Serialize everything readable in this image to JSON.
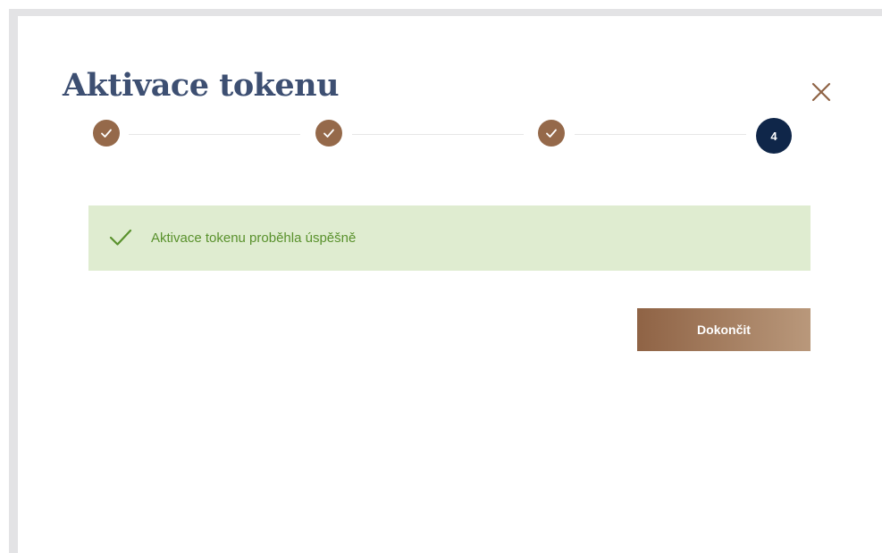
{
  "dialog": {
    "title": "Aktivace tokenu",
    "close_icon": "close-icon"
  },
  "stepper": {
    "steps": [
      {
        "state": "completed",
        "icon": "checkmark-icon"
      },
      {
        "state": "completed",
        "icon": "checkmark-icon"
      },
      {
        "state": "completed",
        "icon": "checkmark-icon"
      },
      {
        "state": "active",
        "label": "4"
      }
    ],
    "active_step": 4,
    "total_steps": 4
  },
  "alert": {
    "type": "success",
    "icon": "checkmark-icon",
    "message": "Aktivace tokenu proběhla úspěšně"
  },
  "actions": {
    "finish_label": "Dokončit"
  },
  "colors": {
    "title": "#3d4f72",
    "step_completed": "#95694a",
    "step_active": "#0f2649",
    "alert_background": "#dfecd0",
    "alert_text": "#59912c",
    "button_gradient_start": "#8f6345",
    "button_gradient_end": "#b9987b",
    "close_icon": "#8f6345"
  }
}
